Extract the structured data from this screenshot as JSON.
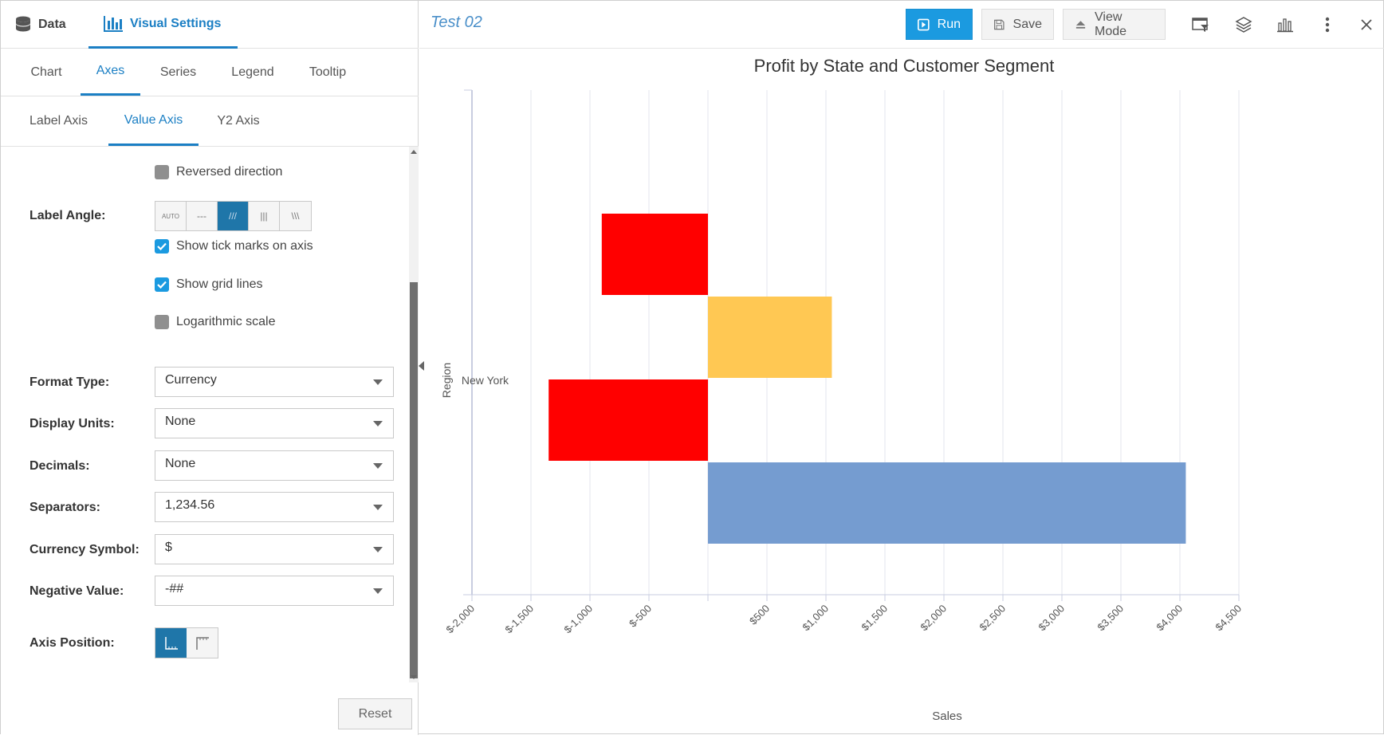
{
  "left_panel": {
    "top_tabs": {
      "data": "Data",
      "visual_settings": "Visual Settings"
    },
    "subtabs": [
      "Chart",
      "Axes",
      "Series",
      "Legend",
      "Tooltip"
    ],
    "axis_tabs": [
      "Label Axis",
      "Value Axis",
      "Y2 Axis"
    ],
    "reversed_direction": {
      "label": "Reversed direction",
      "checked": false
    },
    "label_angle": {
      "label": "Label Angle:",
      "options": [
        "AUTO",
        "---",
        "///",
        "|||",
        "\\\\\\"
      ],
      "selected": "///"
    },
    "show_tick_marks": {
      "label": "Show tick marks on axis",
      "checked": true
    },
    "show_grid_lines": {
      "label": "Show grid lines",
      "checked": true
    },
    "logarithmic_scale": {
      "label": "Logarithmic scale",
      "checked": false
    },
    "format_type": {
      "label": "Format Type:",
      "value": "Currency"
    },
    "display_units": {
      "label": "Display Units:",
      "value": "None"
    },
    "decimals": {
      "label": "Decimals:",
      "value": "None"
    },
    "separators": {
      "label": "Separators:",
      "value": "1,234.56"
    },
    "currency_symbol": {
      "label": "Currency Symbol:",
      "value": "$"
    },
    "negative_value": {
      "label": "Negative Value:",
      "value": "-##"
    },
    "axis_position": {
      "label": "Axis Position:",
      "selected": "bottom"
    },
    "reset_label": "Reset"
  },
  "toolbar": {
    "title": "Test 02",
    "run": "Run",
    "save": "Save",
    "view_mode": "View Mode",
    "icons": [
      "filter-panel-icon",
      "layers-icon",
      "chart-icon",
      "more-vertical-icon",
      "close-icon"
    ]
  },
  "chart_data": {
    "type": "bar",
    "orientation": "horizontal",
    "title": "Profit by State and Customer Segment",
    "xlabel": "Sales",
    "ylabel": "Region",
    "categories": [
      "New York"
    ],
    "bars": [
      {
        "value": -900,
        "color": "#ff0000"
      },
      {
        "value": 1050,
        "color": "#ffc853"
      },
      {
        "value": -1350,
        "color": "#ff0000"
      },
      {
        "value": 4050,
        "color": "#759cd0"
      }
    ],
    "xlim": [
      -2000,
      4500
    ],
    "ticks": [
      "$-2,000",
      "$-1,500",
      "$-1,000",
      "$-500",
      "",
      "$500",
      "$1,000",
      "$1,500",
      "$2,000",
      "$2,500",
      "$3,000",
      "$3,500",
      "$4,000",
      "$4,500"
    ],
    "tick_values": [
      -2000,
      -1500,
      -1000,
      -500,
      0,
      500,
      1000,
      1500,
      2000,
      2500,
      3000,
      3500,
      4000,
      4500
    ],
    "grid": true
  }
}
